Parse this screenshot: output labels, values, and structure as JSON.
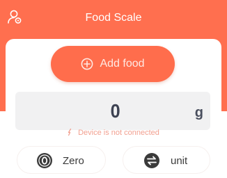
{
  "header": {
    "title": "Food Scale",
    "profile_icon": "user-settings-icon",
    "background": "#ff6f4f"
  },
  "add_food": {
    "label": "Add food",
    "icon": "plus-circle-icon",
    "color": "#ff6d4c"
  },
  "scale": {
    "weight": "0",
    "unit": "g"
  },
  "status": {
    "text": "Device is not connected",
    "icon": "warning-icon",
    "color": "#f2a090"
  },
  "controls": {
    "zero": {
      "label": "Zero",
      "icon": "zero-icon"
    },
    "unit": {
      "label": "unit",
      "icon": "swap-arrows-icon"
    }
  }
}
